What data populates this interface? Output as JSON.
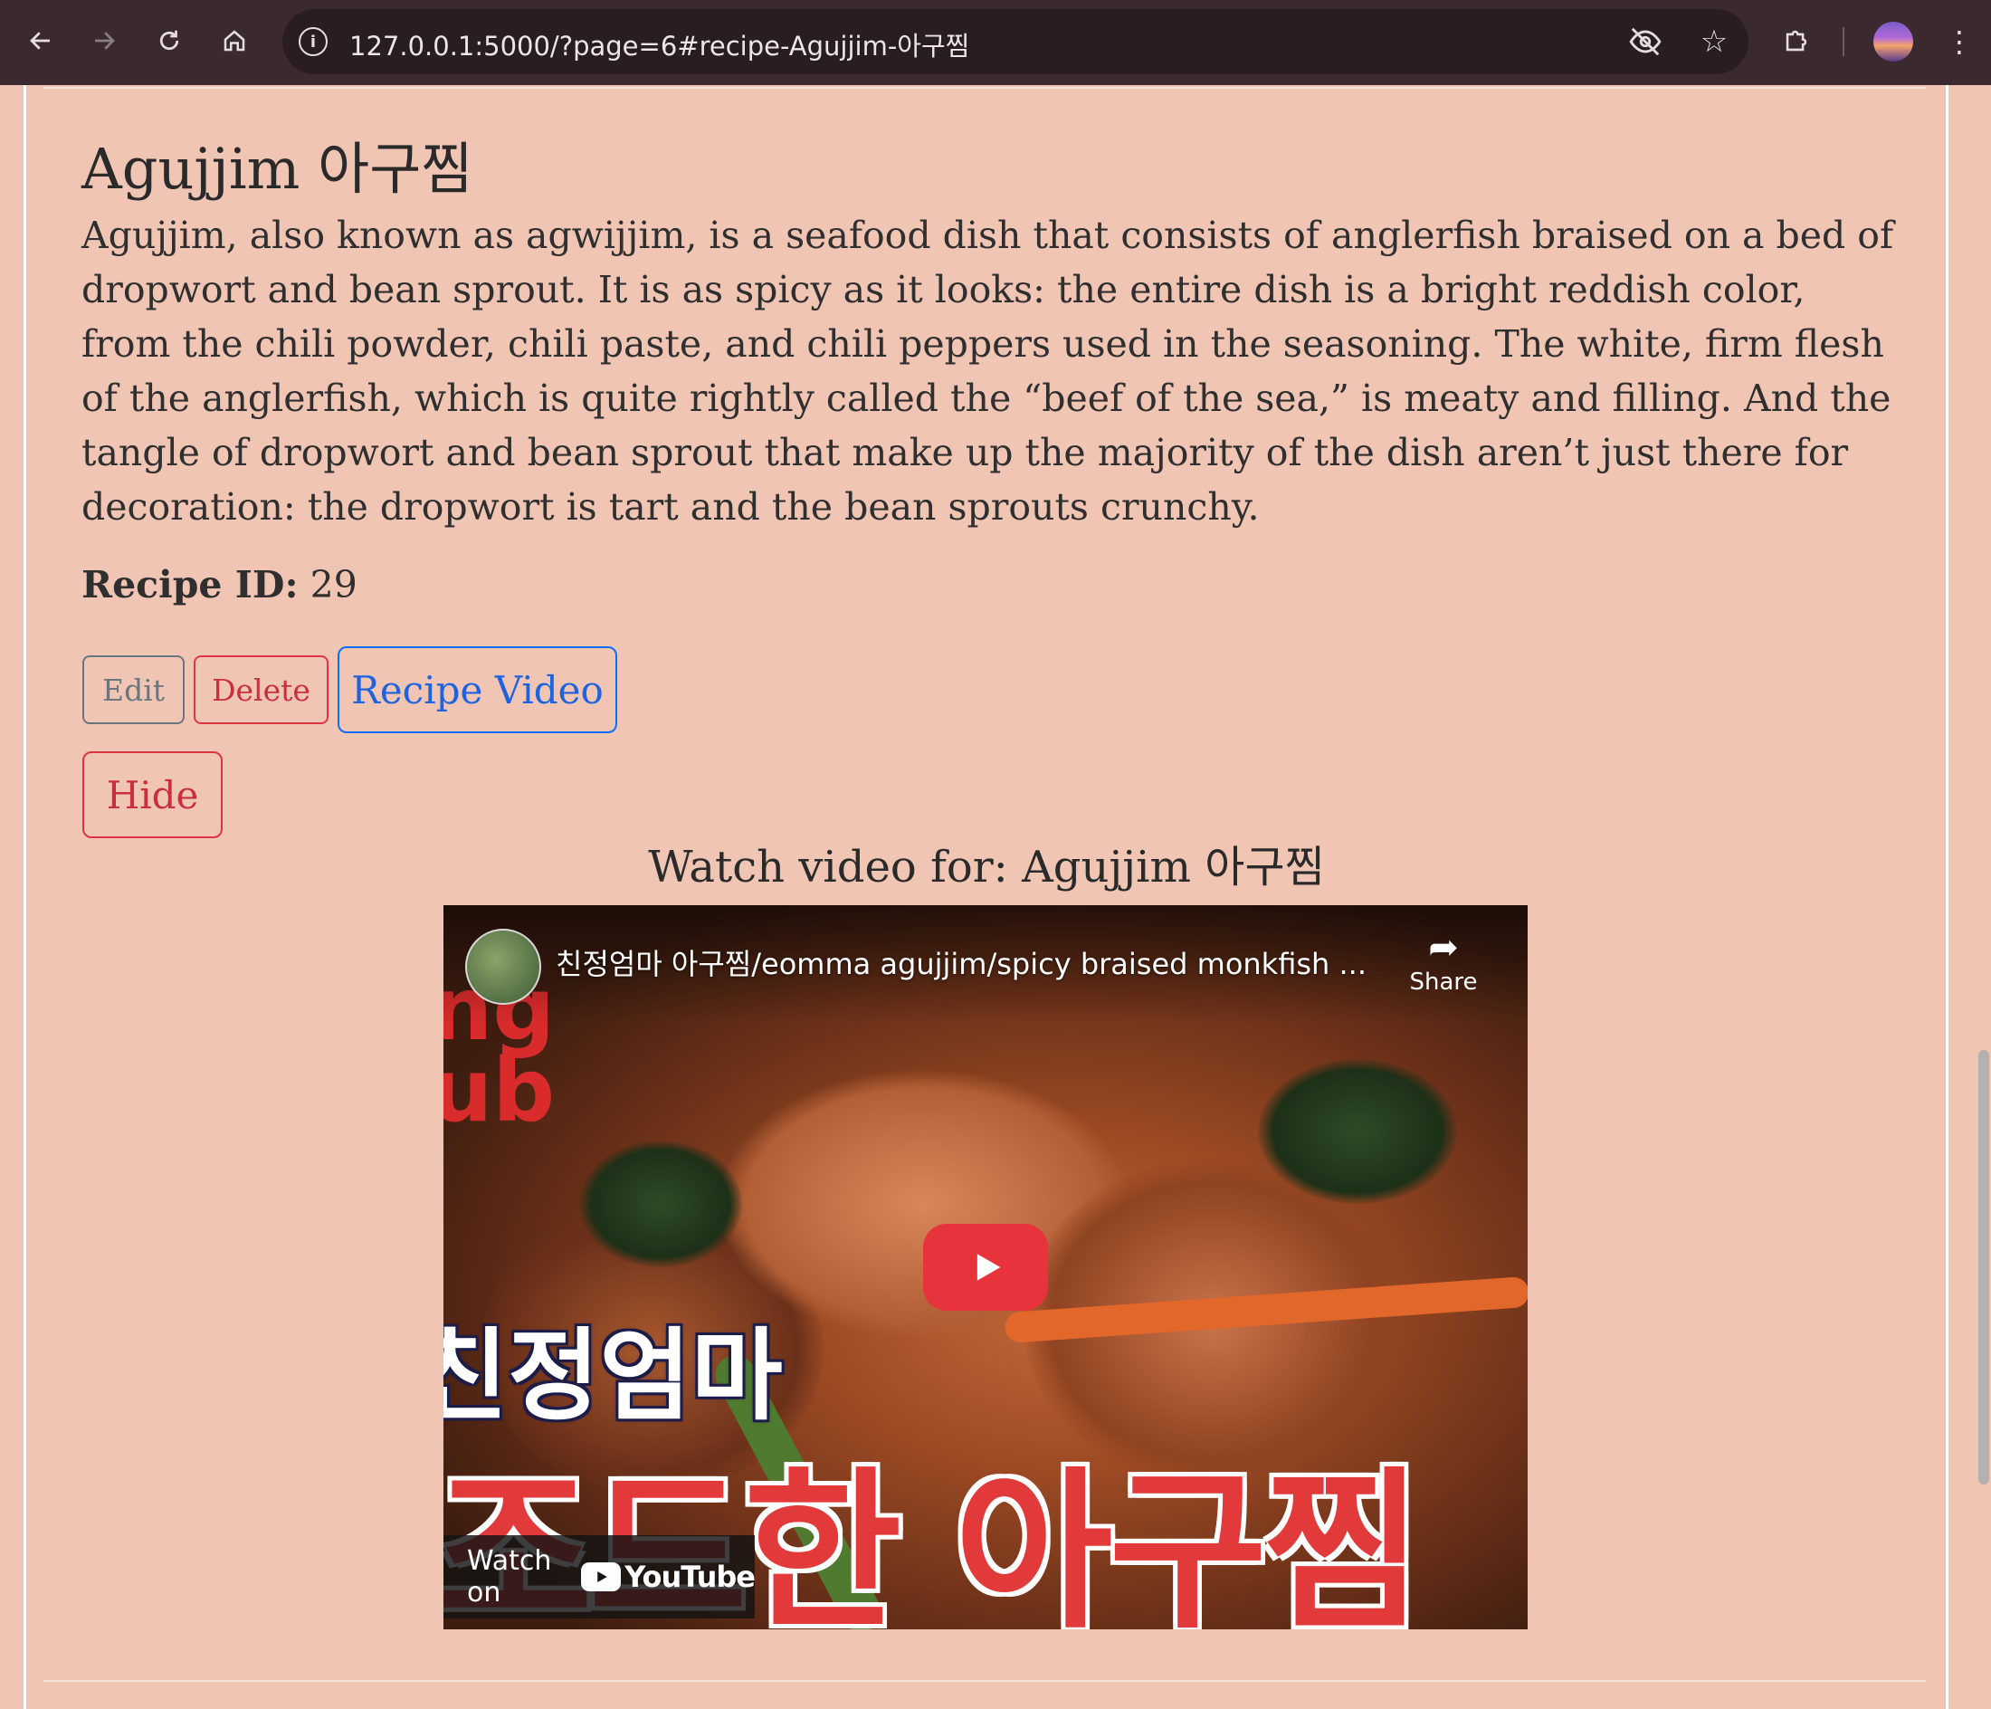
{
  "browser": {
    "url": "127.0.0.1:5000/?page=6#recipe-Agujjim-아구찜",
    "icons": {
      "back": "back-arrow-icon",
      "forward": "forward-arrow-icon",
      "reload": "reload-icon",
      "home": "home-icon",
      "site_info": "site-info-icon",
      "eye_off": "eye-off-icon",
      "bookmark": "star-icon",
      "extensions": "puzzle-icon",
      "menu": "kebab-menu-icon"
    }
  },
  "recipe": {
    "title": "Agujjim 아구찜",
    "description": "Agujjim, also known as agwijjim, is a seafood dish that consists of anglerfish braised on a bed of dropwort and bean sprout. It is as spicy as it looks: the entire dish is a bright reddish color, from the chili powder, chili paste, and chili peppers used in the seasoning. The white, firm flesh of the anglerfish, which is quite rightly called the “beef of the sea,” is meaty and filling. And the tangle of dropwort and bean sprout that make up the majority of the dish aren’t just there for decoration: the dropwort is tart and the bean sprouts crunchy.",
    "id_label": "Recipe ID:",
    "id_value": "29"
  },
  "actions": {
    "edit": "Edit",
    "delete": "Delete",
    "recipe_video": "Recipe Video",
    "hide": "Hide"
  },
  "video": {
    "heading": "Watch video for: Agujjim 아구찜",
    "title": "친정엄마 아구찜/eomma agujjim/spicy braised monkfish ...",
    "share_label": "Share",
    "watch_on": "Watch on",
    "youtube_label": "YouTube",
    "thumbnail_text": {
      "side": "ng\nub",
      "line1": "친정엄마",
      "line2": "조드한 아구찜"
    }
  },
  "colors": {
    "page_background": "#f1c5b4",
    "chrome_background": "#3a2a2f",
    "secondary": "#6c757d",
    "danger": "#dc3545",
    "primary": "#0d6efd",
    "youtube_red": "#e8323c"
  }
}
